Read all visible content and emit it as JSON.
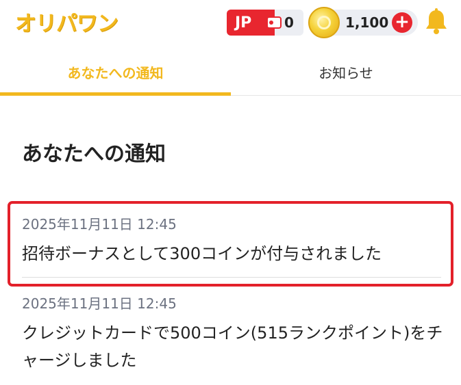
{
  "header": {
    "logo_text": "オリパワン",
    "jp_label": "JP",
    "jp_count": "0",
    "coin_count": "1,100",
    "coin_add_label": "+",
    "accent_color": "#f2b81e",
    "badge_color": "#e8262f",
    "bell_icon": "bell-icon"
  },
  "tabs": [
    {
      "label": "あなたへの通知",
      "active": true
    },
    {
      "label": "お知らせ",
      "active": false
    }
  ],
  "section": {
    "title": "あなたへの通知"
  },
  "notifications": [
    {
      "date": "2025年11月11日 12:45",
      "message": "招待ボーナスとして300コインが付与されました",
      "highlighted": true
    },
    {
      "date": "2025年11月11日 12:45",
      "message": "クレジットカードで500コイン(515ランクポイント)をチャージしました",
      "highlighted": false
    }
  ]
}
